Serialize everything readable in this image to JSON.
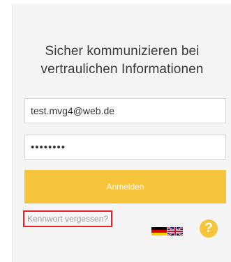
{
  "login": {
    "title_line1": "Sicher kommunizieren bei",
    "title_line2": "vertraulichen Informationen",
    "email_value": "test.mvg4@web.de",
    "password_masked": "••••••••",
    "login_button_label": "Anmelden",
    "forgot_password_label": "Kennwort vergessen?",
    "help_label": "?"
  },
  "languages": [
    {
      "icon": "flag-germany-icon"
    },
    {
      "icon": "flag-uk-icon"
    }
  ],
  "colors": {
    "panel_background": "#f5f5f5",
    "accent": "#f5c43a",
    "highlight_border": "#e52329",
    "link_text": "#a0a0a0"
  }
}
